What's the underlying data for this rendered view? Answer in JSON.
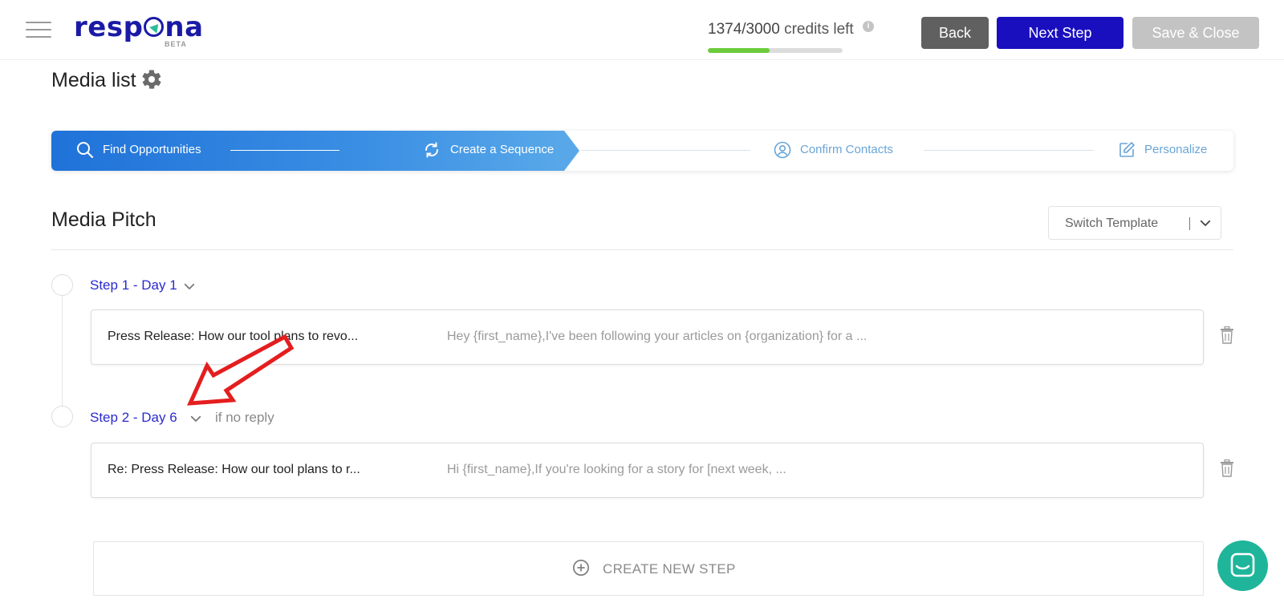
{
  "header": {
    "logo_text_pre": "resp",
    "logo_text_post": "na",
    "logo_sub": "BETA",
    "credits_num": "1374/3000",
    "credits_suffix": " credits left",
    "info_glyph": "i",
    "credits_progress_pct": 45.8,
    "back_label": "Back",
    "next_label": "Next Step",
    "save_label": "Save & Close"
  },
  "page": {
    "title": "Media list"
  },
  "stepper": {
    "steps": [
      {
        "label": "Find Opportunities",
        "icon": "search-icon",
        "state": "done"
      },
      {
        "label": "Create a Sequence",
        "icon": "refresh-icon",
        "state": "active"
      },
      {
        "label": "Confirm Contacts",
        "icon": "user-circle-icon",
        "state": "pending"
      },
      {
        "label": "Personalize",
        "icon": "edit-icon",
        "state": "pending"
      }
    ]
  },
  "sequence": {
    "title": "Media Pitch",
    "switch_template_label": "Switch Template",
    "steps": [
      {
        "label": "Step 1 - Day 1",
        "condition": "",
        "subject": "Press Release: How our tool plans to revo...",
        "preview": "Hey {first_name},I've been following your articles on {organization} for a ..."
      },
      {
        "label": "Step 2 - Day 6",
        "condition": "if no reply",
        "subject": "Re: Press Release: How our tool plans to r...",
        "preview": "Hi {first_name},If you're looking for a story for [next week, ..."
      }
    ],
    "create_step_label": "CREATE NEW STEP"
  },
  "colors": {
    "brand": "#1a1aa6",
    "next_button": "#1a0fbf",
    "back_button": "#606060",
    "save_button_disabled": "#c3c3c3",
    "stepper_active": "#2b7fde",
    "stepper_pending_text": "#6aa5d6",
    "step_link": "#2a2ad0",
    "progress": "#6ccc3c",
    "chat": "#1fb59a",
    "annotation_arrow": "#e41e1e"
  }
}
